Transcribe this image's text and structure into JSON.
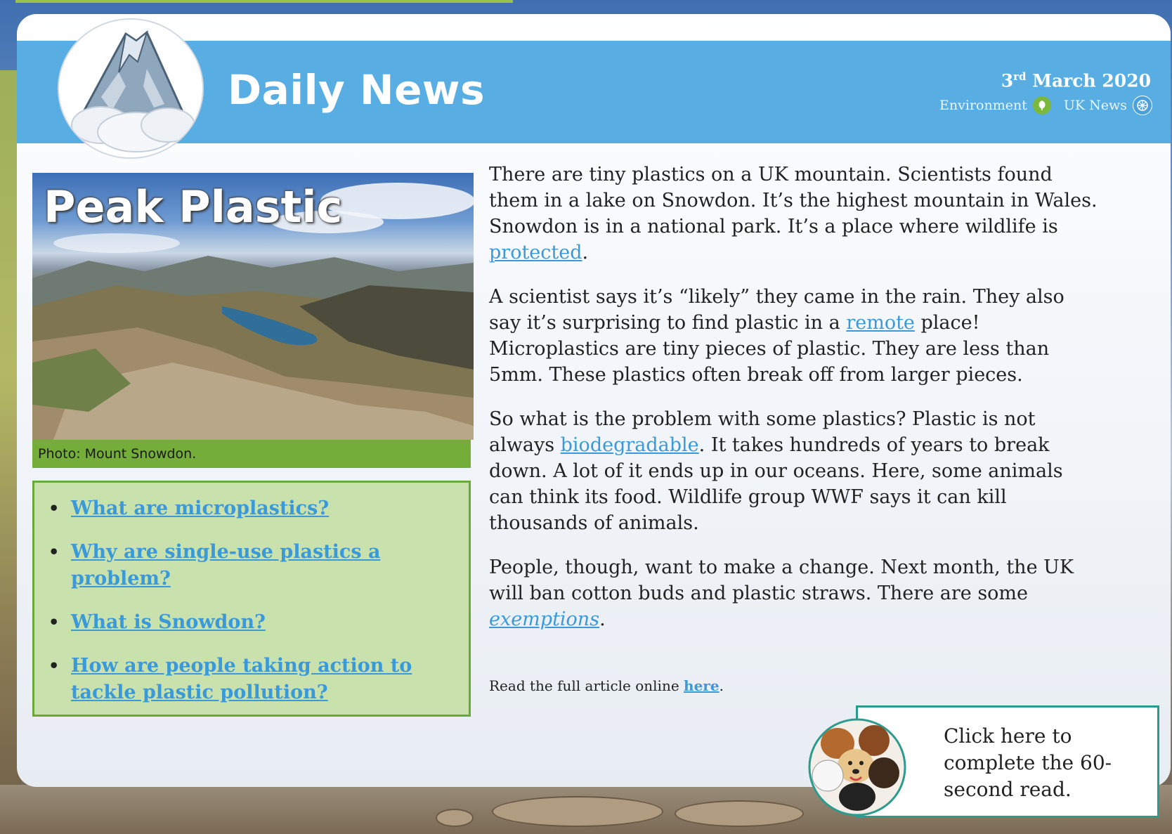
{
  "header": {
    "title": "Daily News",
    "date_prefix": "3",
    "date_suffix": "rd",
    "date_rest": "March 2020",
    "category_1": "Environment",
    "category_2": "UK News",
    "category_1_icon": "leaf-icon",
    "category_2_icon": "globe-icon"
  },
  "article": {
    "headline": "Peak Plastic",
    "photo_caption": "Photo: Mount Snowdon.",
    "p1_before": "There are tiny plastics on a UK mountain. Scientists found them in a lake on Snowdon. It’s the highest mountain in Wales. Snowdon is in a national park. It’s a place where wildlife is ",
    "p1_link": "protected",
    "p1_after": ".",
    "p2_before": "A scientist says it’s “likely” they came in the rain. They also say it’s surprising to find plastic in a ",
    "p2_link": "remote",
    "p2_after": " place! Microplastics are tiny pieces of plastic. They are less than 5mm. These plastics often break off from larger pieces.",
    "p3_before": "So what is the problem with some plastics? Plastic is not always ",
    "p3_link": "biodegradable",
    "p3_after": ". It takes hundreds of years to break down.  A lot of it ends up in our oceans. Here, some animals can think its food. Wildlife group WWF says it can kill thousands of animals.",
    "p4_before": "People, though, want to make a change. Next month, the UK will ban cotton buds and plastic straws. There are some ",
    "p4_link": "exemptions",
    "p4_after": ".",
    "read_more_before": "Read the full article online ",
    "read_more_link": "here",
    "read_more_after": "."
  },
  "questions": [
    "What are microplastics?",
    "Why are single-use plastics a problem?",
    "What is Snowdon?",
    "How are people taking action to tackle plastic pollution?"
  ],
  "cta": {
    "text": "Click here to complete the 60-second read."
  },
  "colors": {
    "header_blue": "#58aee3",
    "link_blue": "#3a9ad9",
    "caption_green": "#75ad3a",
    "questions_bg": "#c9e1ad",
    "cta_border": "#2c9b8e"
  }
}
